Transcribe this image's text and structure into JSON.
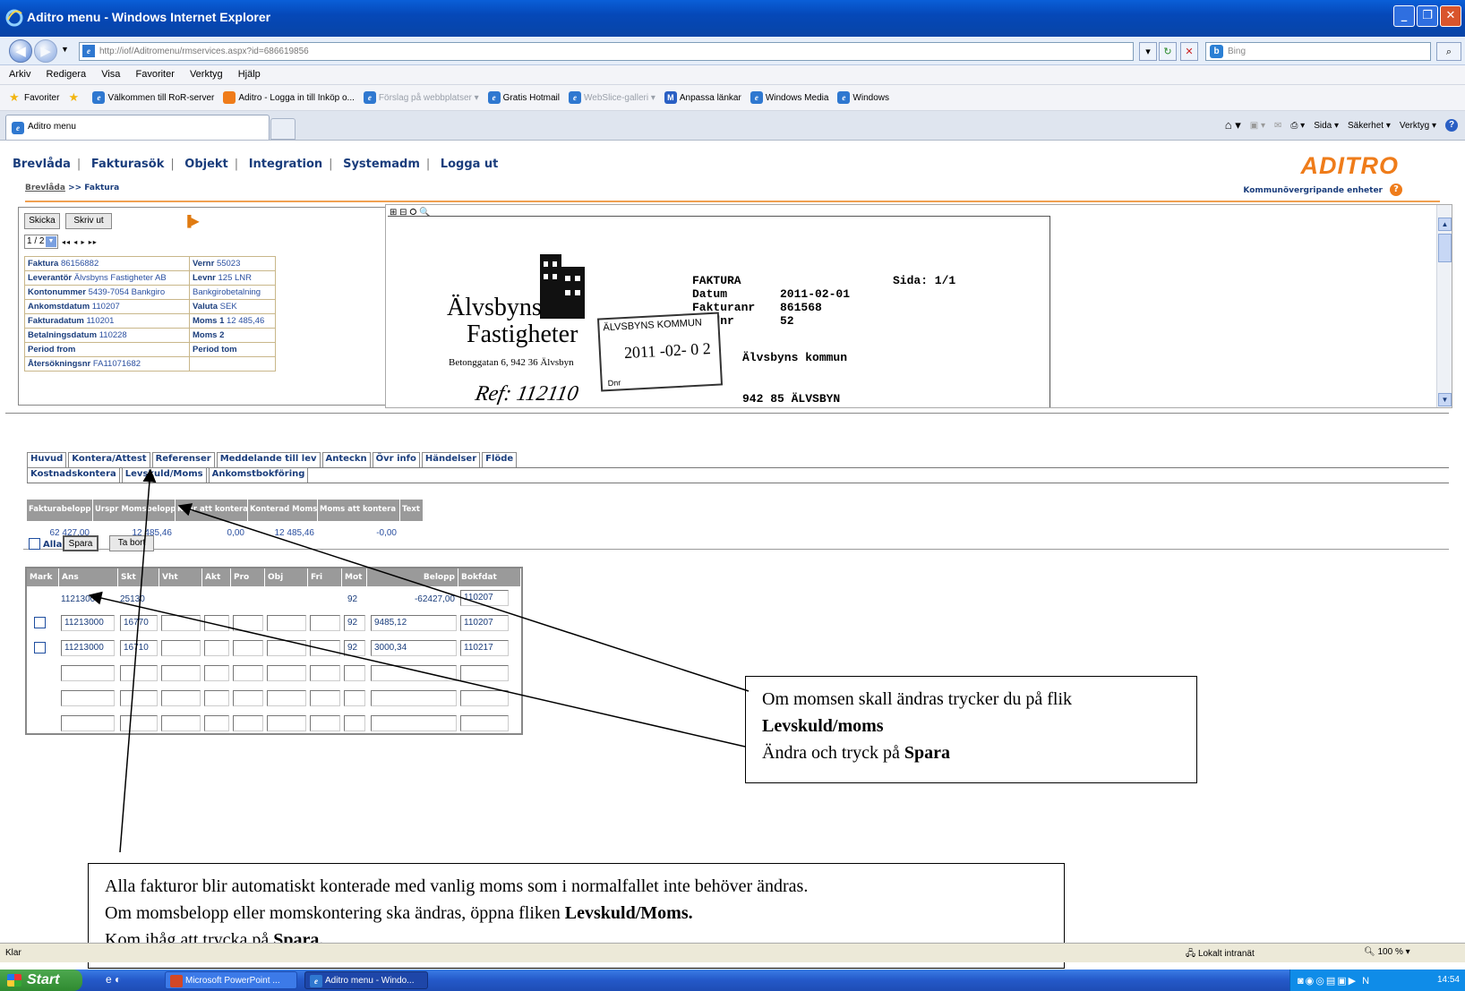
{
  "window": {
    "title": "Aditro menu - Windows Internet Explorer",
    "minimize": "_",
    "restore": "❐",
    "close": "✕"
  },
  "browser": {
    "url": "http://iof/Aditromenu/rmservices.aspx?id=686619856",
    "search_placeholder": "Bing",
    "menu": [
      "Arkiv",
      "Redigera",
      "Visa",
      "Favoriter",
      "Verktyg",
      "Hjälp"
    ],
    "favorites_label": "Favoriter",
    "favorites": [
      {
        "label": "Välkommen till RoR-server"
      },
      {
        "label": "Aditro - Logga in till Inköp o..."
      },
      {
        "label": "Förslag på webbplatser ▾"
      },
      {
        "label": "Gratis Hotmail"
      },
      {
        "label": "WebSlice-galleri ▾"
      },
      {
        "label": "Anpassa länkar"
      },
      {
        "label": "Windows Media"
      },
      {
        "label": "Windows"
      }
    ],
    "tab_title": "Aditro menu",
    "commands": [
      "Sida ▾",
      "Säkerhet ▾",
      "Verktyg ▾"
    ]
  },
  "app": {
    "nav": [
      "Brevlåda",
      "Fakturasök",
      "Objekt",
      "Integration",
      "Systemadm",
      "Logga ut"
    ],
    "breadcrumb_link": "Brevlåda",
    "breadcrumb_current": ">> Faktura",
    "logo": "ADITRO",
    "unit_label": "Kommunövergripande enheter"
  },
  "invoice": {
    "send_button": "Skicka",
    "print_button": "Skriv ut",
    "page_select": "1 / 2",
    "pager_arrows": "◂◂ ◂ ▸ ▸▸",
    "fields": [
      {
        "l1": "Faktura",
        "v1": "86156882",
        "l2": "Vernr",
        "v2": "55023"
      },
      {
        "l1": "Leverantör",
        "v1": "Älvsbyns Fastigheter AB",
        "l2": "Levnr",
        "v2": "125 LNR"
      },
      {
        "l1": "Kontonummer",
        "v1": "5439-7054 Bankgiro",
        "l2": "",
        "v2": "Bankgirobetalning"
      },
      {
        "l1": "Ankomstdatum",
        "v1": "110207",
        "l2": "Valuta",
        "v2": "SEK"
      },
      {
        "l1": "Fakturadatum",
        "v1": "110201",
        "l2": "Moms 1",
        "v2": "12 485,46"
      },
      {
        "l1": "Betalningsdatum",
        "v1": "110228",
        "l2": "Moms 2",
        "v2": ""
      },
      {
        "l1": "Period from",
        "v1": "",
        "l2": "Period tom",
        "v2": ""
      },
      {
        "l1": "Återsökningsnr",
        "v1": "FA11071682",
        "l2": "",
        "v2": ""
      }
    ]
  },
  "document": {
    "tools": "⊞ ⊟ ⭘ 🔍",
    "company_line1": "Älvsbyns",
    "company_line2": "Fastigheter",
    "company_addr": "Betonggatan 6, 942 36 Älvsbyn",
    "ref_handwritten": "Ref: 112110",
    "faktura": "FAKTURA",
    "sida": "Sida: 1/1",
    "datum_label": "Datum",
    "datum": "2011-02-01",
    "fakturanr_label": "Fakturanr",
    "fakturanr": "861568",
    "kundnr_label": "Kundnr",
    "kundnr": "52",
    "stamp_title": "ÄLVSBYNS KOMMUN",
    "stamp_date": "2011 -02- 0 2",
    "stamp_dnr": "Dnr",
    "recipient": "Älvsbyns kommun",
    "recipient_addr": "942 85 ÄLVSBYN"
  },
  "tabs": {
    "row1": [
      "Huvud",
      "Kontera/Attest",
      "Referenser",
      "Meddelande till lev",
      "Anteckn",
      "Övr info",
      "Händelser",
      "Flöde"
    ],
    "row2": [
      "Kostnadskontera",
      "Levskuld/Moms",
      "Ankomstbokföring"
    ]
  },
  "totals": {
    "headers": [
      "Fakturabelopp",
      "Urspr Momsbelopp",
      "Kvar att kontera",
      "Konterad Moms",
      "Moms att kontera",
      "Text"
    ],
    "values": [
      "62 427,00",
      "12 485,46",
      "0,00",
      "12 485,46",
      "-0,00",
      ""
    ]
  },
  "actions": {
    "all_label": "Alla",
    "save": "Spara",
    "delete": "Ta bort"
  },
  "grid": {
    "headers": [
      "Mark",
      "Ans",
      "Skt",
      "Vht",
      "Akt",
      "Pro",
      "Obj",
      "Fri",
      "Mot",
      "Belopp",
      "Bokfdat"
    ],
    "rows": [
      {
        "ans": "11213000",
        "skt": "25130",
        "mot": "92",
        "belopp": "-62427,00",
        "bokfdat": "110207"
      },
      {
        "ans": "11213000",
        "skt": "16770",
        "mot": "92",
        "belopp": "9485,12",
        "bokfdat": "110207"
      },
      {
        "ans": "11213000",
        "skt": "16710",
        "mot": "92",
        "belopp": "3000,34",
        "bokfdat": "110217"
      }
    ]
  },
  "callouts": {
    "right_line1": "Om momsen skall ändras trycker du på flik",
    "right_line2_bold": "Levskuld/moms",
    "right_line3": "Ändra och tryck på ",
    "right_line3_bold": "Spara",
    "bottom_line1": "Alla fakturor blir automatiskt konterade med vanlig moms som i normalfallet inte behöver ändras.",
    "bottom_line2": "Om momsbelopp eller momskontering ska ändras, öppna fliken ",
    "bottom_line2_bold": "Levskuld/Moms.",
    "bottom_line3": "Kom ihåg att trycka på ",
    "bottom_line3_bold": "Spara."
  },
  "status": {
    "text": "Klar",
    "zone": "Lokalt intranät",
    "zoom": "100 %"
  },
  "taskbar": {
    "start": "Start",
    "tasks": [
      "Microsoft PowerPoint ...",
      "Aditro menu - Windo..."
    ],
    "clock": "14:54"
  },
  "colors": {
    "nav_text": "#1a3d7c",
    "brand": "#ef7c1a",
    "header_grey": "#9a9a9a"
  }
}
